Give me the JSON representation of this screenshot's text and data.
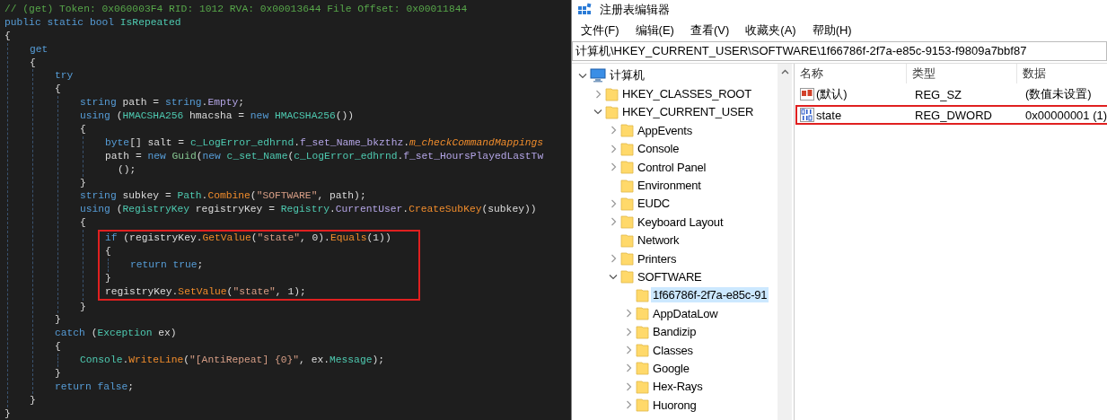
{
  "code_editor": {
    "lines": [
      {
        "kind": "line",
        "tokens": [
          {
            "kind": "comment",
            "text": "// (get) Token: 0x060003F4 RID: 1012 RVA: 0x00013644 File Offset: 0x00011844"
          }
        ]
      },
      {
        "kind": "line",
        "tokens": [
          {
            "kind": "keyword",
            "text": "public static bool"
          },
          {
            "kind": "type",
            "text": " IsRepeated"
          }
        ]
      },
      {
        "kind": "line",
        "tokens": [
          {
            "kind": "plain",
            "text": "{"
          }
        ],
        "children": [
          {
            "kind": "line",
            "tokens": [
              {
                "kind": "keyword",
                "text": "get"
              }
            ]
          },
          {
            "kind": "line",
            "tokens": [
              {
                "kind": "plain",
                "text": "{"
              }
            ],
            "children": [
              {
                "kind": "line",
                "tokens": [
                  {
                    "kind": "keyword",
                    "text": "try"
                  }
                ]
              },
              {
                "kind": "line",
                "tokens": [
                  {
                    "kind": "plain",
                    "text": "{"
                  }
                ],
                "children": [
                  {
                    "kind": "line",
                    "tokens": [
                      {
                        "kind": "keyword",
                        "text": "string"
                      },
                      {
                        "kind": "plain",
                        "text": " path = "
                      },
                      {
                        "kind": "keyword",
                        "text": "string"
                      },
                      {
                        "kind": "plain",
                        "text": "."
                      },
                      {
                        "kind": "member",
                        "text": "Empty"
                      },
                      {
                        "kind": "plain",
                        "text": ";"
                      }
                    ]
                  },
                  {
                    "kind": "line",
                    "tokens": [
                      {
                        "kind": "keyword",
                        "text": "using"
                      },
                      {
                        "kind": "plain",
                        "text": " ("
                      },
                      {
                        "kind": "type",
                        "text": "HMACSHA256"
                      },
                      {
                        "kind": "plain",
                        "text": " hmacsha = "
                      },
                      {
                        "kind": "keyword",
                        "text": "new"
                      },
                      {
                        "kind": "type",
                        "text": " HMACSHA256"
                      },
                      {
                        "kind": "plain",
                        "text": "())"
                      }
                    ]
                  },
                  {
                    "kind": "line",
                    "tokens": [
                      {
                        "kind": "plain",
                        "text": "{"
                      }
                    ],
                    "children": [
                      {
                        "kind": "line",
                        "tokens": [
                          {
                            "kind": "keyword",
                            "text": "byte"
                          },
                          {
                            "kind": "plain",
                            "text": "[] salt = "
                          },
                          {
                            "kind": "type",
                            "text": "c_LogError_edhrnd"
                          },
                          {
                            "kind": "plain",
                            "text": "."
                          },
                          {
                            "kind": "member",
                            "text": "f_set_Name_bkzthz"
                          },
                          {
                            "kind": "plain",
                            "text": "."
                          },
                          {
                            "kind": "field",
                            "text": "m_checkCommandMappings"
                          }
                        ]
                      },
                      {
                        "kind": "line",
                        "tokens": [
                          {
                            "kind": "plain",
                            "text": "path = "
                          },
                          {
                            "kind": "keyword",
                            "text": "new"
                          },
                          {
                            "kind": "struct",
                            "text": " Guid"
                          },
                          {
                            "kind": "plain",
                            "text": "("
                          },
                          {
                            "kind": "keyword",
                            "text": "new"
                          },
                          {
                            "kind": "type",
                            "text": " c_set_Name"
                          },
                          {
                            "kind": "plain",
                            "text": "("
                          },
                          {
                            "kind": "type",
                            "text": "c_LogError_edhrnd"
                          },
                          {
                            "kind": "plain",
                            "text": "."
                          },
                          {
                            "kind": "member",
                            "text": "f_set_HoursPlayedLastTw"
                          }
                        ]
                      },
                      {
                        "kind": "wrap",
                        "tokens": [
                          {
                            "kind": "plain",
                            "text": "();"
                          }
                        ]
                      }
                    ]
                  },
                  {
                    "kind": "line",
                    "tokens": [
                      {
                        "kind": "plain",
                        "text": "}"
                      }
                    ]
                  },
                  {
                    "kind": "line",
                    "tokens": [
                      {
                        "kind": "keyword",
                        "text": "string"
                      },
                      {
                        "kind": "plain",
                        "text": " subkey = "
                      },
                      {
                        "kind": "type",
                        "text": "Path"
                      },
                      {
                        "kind": "plain",
                        "text": "."
                      },
                      {
                        "kind": "method",
                        "text": "Combine"
                      },
                      {
                        "kind": "plain",
                        "text": "("
                      },
                      {
                        "kind": "string",
                        "text": "\"SOFTWARE\""
                      },
                      {
                        "kind": "plain",
                        "text": ", path);"
                      }
                    ]
                  },
                  {
                    "kind": "line",
                    "tokens": [
                      {
                        "kind": "keyword",
                        "text": "using"
                      },
                      {
                        "kind": "plain",
                        "text": " ("
                      },
                      {
                        "kind": "type",
                        "text": "RegistryKey"
                      },
                      {
                        "kind": "plain",
                        "text": " registryKey = "
                      },
                      {
                        "kind": "type",
                        "text": "Registry"
                      },
                      {
                        "kind": "plain",
                        "text": "."
                      },
                      {
                        "kind": "member",
                        "text": "CurrentUser"
                      },
                      {
                        "kind": "plain",
                        "text": "."
                      },
                      {
                        "kind": "method",
                        "text": "CreateSubKey"
                      },
                      {
                        "kind": "plain",
                        "text": "(subkey))"
                      }
                    ]
                  },
                  {
                    "kind": "line",
                    "tokens": [
                      {
                        "kind": "plain",
                        "text": "{"
                      }
                    ],
                    "children": [
                      {
                        "kind": "box",
                        "lines": [
                          {
                            "kind": "line",
                            "tokens": [
                              {
                                "kind": "keyword",
                                "text": "if"
                              },
                              {
                                "kind": "plain",
                                "text": " (registryKey."
                              },
                              {
                                "kind": "method",
                                "text": "GetValue"
                              },
                              {
                                "kind": "plain",
                                "text": "("
                              },
                              {
                                "kind": "string",
                                "text": "\"state\""
                              },
                              {
                                "kind": "plain",
                                "text": ", 0)."
                              },
                              {
                                "kind": "method",
                                "text": "Equals"
                              },
                              {
                                "kind": "plain",
                                "text": "(1))"
                              }
                            ]
                          },
                          {
                            "kind": "line",
                            "tokens": [
                              {
                                "kind": "plain",
                                "text": "{"
                              }
                            ],
                            "children": [
                              {
                                "kind": "line",
                                "tokens": [
                                  {
                                    "kind": "keyword",
                                    "text": "return true"
                                  },
                                  {
                                    "kind": "plain",
                                    "text": ";"
                                  }
                                ]
                              }
                            ]
                          },
                          {
                            "kind": "line",
                            "tokens": [
                              {
                                "kind": "plain",
                                "text": "}"
                              }
                            ]
                          },
                          {
                            "kind": "line",
                            "tokens": [
                              {
                                "kind": "plain",
                                "text": "registryKey."
                              },
                              {
                                "kind": "method",
                                "text": "SetValue"
                              },
                              {
                                "kind": "plain",
                                "text": "("
                              },
                              {
                                "kind": "string",
                                "text": "\"state\""
                              },
                              {
                                "kind": "plain",
                                "text": ", 1);"
                              }
                            ]
                          }
                        ]
                      }
                    ]
                  },
                  {
                    "kind": "line",
                    "tokens": [
                      {
                        "kind": "plain",
                        "text": "}"
                      }
                    ]
                  }
                ]
              },
              {
                "kind": "line",
                "tokens": [
                  {
                    "kind": "plain",
                    "text": "}"
                  }
                ]
              },
              {
                "kind": "line",
                "tokens": [
                  {
                    "kind": "keyword",
                    "text": "catch"
                  },
                  {
                    "kind": "plain",
                    "text": " ("
                  },
                  {
                    "kind": "type",
                    "text": "Exception"
                  },
                  {
                    "kind": "plain",
                    "text": " ex)"
                  }
                ]
              },
              {
                "kind": "line",
                "tokens": [
                  {
                    "kind": "plain",
                    "text": "{"
                  }
                ],
                "children": [
                  {
                    "kind": "line",
                    "tokens": [
                      {
                        "kind": "type",
                        "text": "Console"
                      },
                      {
                        "kind": "plain",
                        "text": "."
                      },
                      {
                        "kind": "method",
                        "text": "WriteLine"
                      },
                      {
                        "kind": "plain",
                        "text": "("
                      },
                      {
                        "kind": "string",
                        "text": "\"[AntiRepeat] {0}\""
                      },
                      {
                        "kind": "plain",
                        "text": ", ex."
                      },
                      {
                        "kind": "type",
                        "text": "Message"
                      },
                      {
                        "kind": "plain",
                        "text": ");"
                      }
                    ]
                  }
                ]
              },
              {
                "kind": "line",
                "tokens": [
                  {
                    "kind": "plain",
                    "text": "}"
                  }
                ]
              },
              {
                "kind": "line",
                "tokens": [
                  {
                    "kind": "keyword",
                    "text": "return false"
                  },
                  {
                    "kind": "plain",
                    "text": ";"
                  }
                ]
              }
            ]
          },
          {
            "kind": "line",
            "tokens": [
              {
                "kind": "plain",
                "text": "}"
              }
            ]
          }
        ]
      },
      {
        "kind": "line",
        "tokens": [
          {
            "kind": "plain",
            "text": "}"
          }
        ]
      }
    ]
  },
  "registry_editor": {
    "title": "注册表编辑器",
    "menu": [
      "文件(F)",
      "编辑(E)",
      "查看(V)",
      "收藏夹(A)",
      "帮助(H)"
    ],
    "address": "计算机\\HKEY_CURRENT_USER\\SOFTWARE\\1f66786f-2f7a-e85c-9153-f9809a7bbf87",
    "tree": [
      {
        "label": "计算机",
        "kind": "computer",
        "expanded": true,
        "selected": false,
        "children": [
          {
            "label": "HKEY_CLASSES_ROOT",
            "kind": "folder",
            "expanded": false,
            "selected": false
          },
          {
            "label": "HKEY_CURRENT_USER",
            "kind": "folder",
            "expanded": true,
            "selected": false,
            "children": [
              {
                "label": "AppEvents",
                "kind": "folder",
                "expanded": false,
                "selected": false
              },
              {
                "label": "Console",
                "kind": "folder",
                "expanded": false,
                "selected": false
              },
              {
                "label": "Control Panel",
                "kind": "folder",
                "expanded": false,
                "selected": false
              },
              {
                "label": "Environment",
                "kind": "folder",
                "selected": false
              },
              {
                "label": "EUDC",
                "kind": "folder",
                "expanded": false,
                "selected": false
              },
              {
                "label": "Keyboard Layout",
                "kind": "folder",
                "expanded": false,
                "selected": false
              },
              {
                "label": "Network",
                "kind": "folder",
                "selected": false
              },
              {
                "label": "Printers",
                "kind": "folder",
                "expanded": false,
                "selected": false
              },
              {
                "label": "SOFTWARE",
                "kind": "folder",
                "expanded": true,
                "selected": false,
                "children": [
                  {
                    "label": "1f66786f-2f7a-e85c-91",
                    "kind": "folder",
                    "selected": true
                  },
                  {
                    "label": "AppDataLow",
                    "kind": "folder",
                    "expanded": false,
                    "selected": false
                  },
                  {
                    "label": "Bandizip",
                    "kind": "folder",
                    "expanded": false,
                    "selected": false
                  },
                  {
                    "label": "Classes",
                    "kind": "folder",
                    "expanded": false,
                    "selected": false
                  },
                  {
                    "label": "Google",
                    "kind": "folder",
                    "expanded": false,
                    "selected": false
                  },
                  {
                    "label": "Hex-Rays",
                    "kind": "folder",
                    "expanded": false,
                    "selected": false
                  },
                  {
                    "label": "Huorong",
                    "kind": "folder",
                    "expanded": false,
                    "selected": false
                  }
                ]
              }
            ]
          }
        ]
      }
    ],
    "columns": [
      "名称",
      "类型",
      "数据"
    ],
    "values": [
      {
        "kind": "string",
        "name": "(默认)",
        "type": "REG_SZ",
        "data": "(数值未设置)",
        "highlighted": false
      },
      {
        "kind": "dword",
        "name": "state",
        "type": "REG_DWORD",
        "data": "0x00000001 (1)",
        "highlighted": true
      }
    ]
  }
}
